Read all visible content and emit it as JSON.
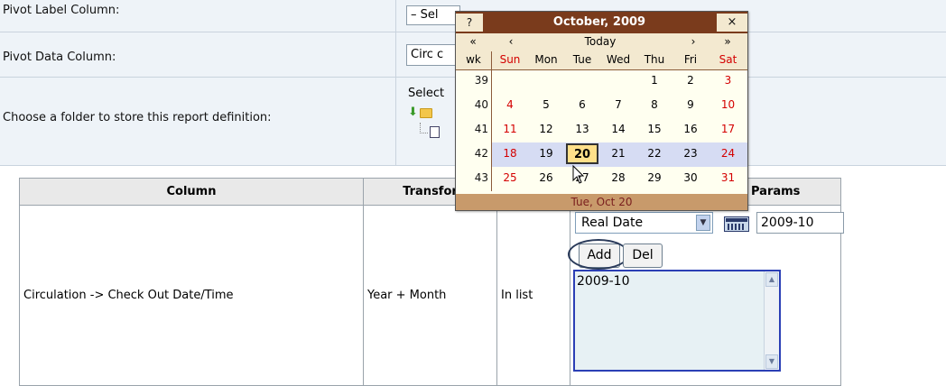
{
  "form": {
    "pivot_label": {
      "label": "Pivot Label Column:",
      "value": "– Sel"
    },
    "pivot_data": {
      "label": "Pivot Data Column:",
      "value": "Circ c"
    },
    "folder": {
      "label": "Choose a folder to store this report definition:",
      "select_prefix": "Select"
    }
  },
  "table": {
    "headers": {
      "column": "Column",
      "transform": "Transfor",
      "params": "Params"
    },
    "row": {
      "column": "Circulation -> Check Out Date/Time",
      "transform": "Year + Month",
      "operator": "In list",
      "param_type": "Real Date",
      "param_value": "2009-10",
      "add_label": "Add",
      "del_label": "Del",
      "list_value": "2009-10"
    }
  },
  "calendar": {
    "title": "October, 2009",
    "help": "?",
    "close": "×",
    "nav": {
      "prev_year": "«",
      "prev_month": "‹",
      "today": "Today",
      "next_month": "›",
      "next_year": "»"
    },
    "day_names": [
      "wk",
      "Sun",
      "Mon",
      "Tue",
      "Wed",
      "Thu",
      "Fri",
      "Sat"
    ],
    "weeks": [
      {
        "wk": "39",
        "days": [
          "",
          "",
          "",
          "",
          "1",
          "2",
          "3"
        ]
      },
      {
        "wk": "40",
        "days": [
          "4",
          "5",
          "6",
          "7",
          "8",
          "9",
          "10"
        ]
      },
      {
        "wk": "41",
        "days": [
          "11",
          "12",
          "13",
          "14",
          "15",
          "16",
          "17"
        ]
      },
      {
        "wk": "42",
        "days": [
          "18",
          "19",
          "20",
          "21",
          "22",
          "23",
          "24"
        ]
      },
      {
        "wk": "43",
        "days": [
          "25",
          "26",
          "27",
          "28",
          "29",
          "30",
          "31"
        ]
      }
    ],
    "selected_day": "20",
    "status": "Tue, Oct 20"
  }
}
